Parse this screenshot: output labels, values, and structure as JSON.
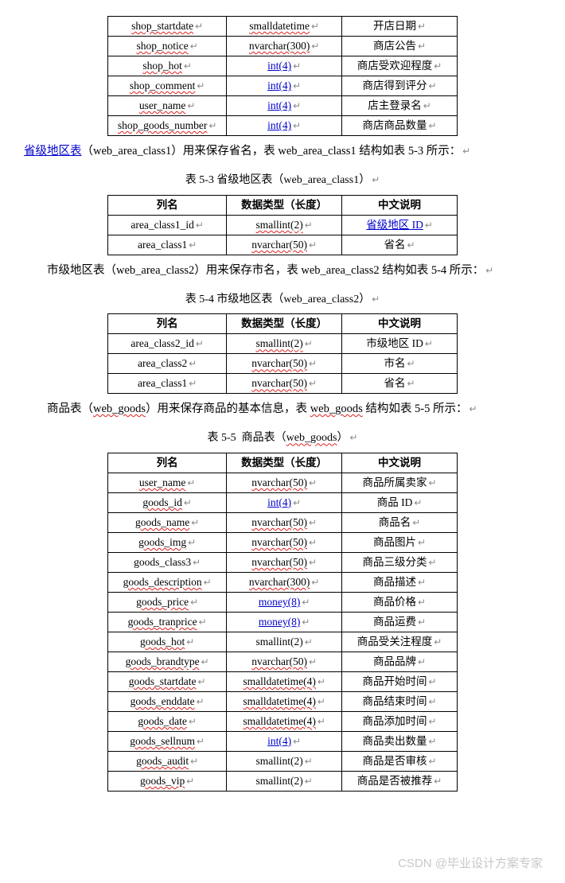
{
  "table1": {
    "rows": [
      {
        "c1": "shop_startdate",
        "c1_err": true,
        "c2": "smalldatetime",
        "c2_err": true,
        "c3": "开店日期"
      },
      {
        "c1": "shop_notice",
        "c1_err": true,
        "c2": "nvarchar(300)",
        "c2_err": true,
        "c3": "商店公告"
      },
      {
        "c1": "shop_hot",
        "c1_err": true,
        "c2": "int(4)",
        "c2_link": true,
        "c3": "商店受欢迎程度"
      },
      {
        "c1": "shop_comment",
        "c1_err": true,
        "c2": "int(4)",
        "c2_link": true,
        "c3": "商店得到评分"
      },
      {
        "c1": "user_name",
        "c1_err": true,
        "c2": "int(4)",
        "c2_link": true,
        "c3": "店主登录名"
      },
      {
        "c1": "shop_goods_number",
        "c1_err": true,
        "c2": "int(4)",
        "c2_link": true,
        "c3": "商店商品数量"
      }
    ]
  },
  "para1_text": "省级地区表（web_area_class1）用来保存省名，表 web_area_class1 结构如表 5-3 所示：",
  "caption53": "表 5-3  省级地区表（web_area_class1）",
  "table53": {
    "header": {
      "c1": "列名",
      "c2": "数据类型（长度）",
      "c3": "中文说明"
    },
    "rows": [
      {
        "c1": "area_class1_id",
        "c2": "smallint(2)",
        "c2_err": true,
        "c3": "省级地区 ID",
        "c3_link": true
      },
      {
        "c1": "area_class1",
        "c2": "nvarchar(50)",
        "c2_err": true,
        "c3": "省名"
      }
    ]
  },
  "para2_text": "市级地区表（web_area_class2）用来保存市名，表 web_area_class2 结构如表 5-4 所示：",
  "caption54": "表 5-4  市级地区表（web_area_class2）",
  "table54": {
    "header": {
      "c1": "列名",
      "c2": "数据类型（长度）",
      "c3": "中文说明"
    },
    "rows": [
      {
        "c1": "area_class2_id",
        "c2": "smallint(2)",
        "c2_err": true,
        "c3": "市级地区 ID"
      },
      {
        "c1": "area_class2",
        "c2": "nvarchar(50)",
        "c2_err": true,
        "c3": "市名"
      },
      {
        "c1": "area_class1",
        "c2": "nvarchar(50)",
        "c2_err": true,
        "c3": "省名"
      }
    ]
  },
  "para3_text": "商品表（web_goods）用来保存商品的基本信息，表 web_goods 结构如表 5-5 所示：",
  "caption55": "表 5-5  商品表（web_goods）",
  "table55": {
    "header": {
      "c1": "列名",
      "c2": "数据类型（长度）",
      "c3": "中文说明"
    },
    "rows": [
      {
        "c1": "user_name",
        "c1_err": true,
        "c2": "nvarchar(50)",
        "c2_err": true,
        "c3": "商品所属卖家"
      },
      {
        "c1": "goods_id",
        "c1_err": true,
        "c2": "int(4)",
        "c2_link": true,
        "c3": "商品 ID"
      },
      {
        "c1": "goods_name",
        "c1_err": true,
        "c2": "nvarchar(50)",
        "c2_err": true,
        "c3": "商品名"
      },
      {
        "c1": "goods_img",
        "c1_err": true,
        "c2": "nvarchar(50)",
        "c2_err": true,
        "c3": "商品图片"
      },
      {
        "c1": "goods_class3",
        "c2": "nvarchar(50)",
        "c2_err": true,
        "c3": "商品三级分类"
      },
      {
        "c1": "goods_description",
        "c1_err": true,
        "c2": "nvarchar(300)",
        "c2_err": true,
        "c3": "商品描述"
      },
      {
        "c1": "goods_price",
        "c1_err": true,
        "c2": "money(8)",
        "c2_link": true,
        "c3": "商品价格"
      },
      {
        "c1": "goods_tranprice",
        "c1_err": true,
        "c2": "money(8)",
        "c2_link": true,
        "c3": "商品运费"
      },
      {
        "c1": "goods_hot",
        "c1_err": true,
        "c2": "smallint(2)",
        "c3": "商品受关注程度"
      },
      {
        "c1": "goods_brandtype",
        "c1_err": true,
        "c2": "nvarchar(50)",
        "c2_err": true,
        "c3": "商品品牌"
      },
      {
        "c1": "goods_startdate",
        "c1_err": true,
        "c2": "smalldatetime(4)",
        "c2_err": true,
        "c3": "商品开始时间"
      },
      {
        "c1": "goods_enddate",
        "c1_err": true,
        "c2": "smalldatetime(4)",
        "c2_err": true,
        "c3": "商品结束时间"
      },
      {
        "c1": "goods_date",
        "c1_err": true,
        "c2": "smalldatetime(4)",
        "c2_err": true,
        "c3": "商品添加时间"
      },
      {
        "c1": "goods_sellnum",
        "c1_err": true,
        "c2": "int(4)",
        "c2_link": true,
        "c3": "商品卖出数量"
      },
      {
        "c1": "goods_audit",
        "c1_err": true,
        "c2": "smallint(2)",
        "c3": "商品是否审核"
      },
      {
        "c1": "goods_vip",
        "c1_err": true,
        "c2": "smallint(2)",
        "c3": "商品是否被推荐"
      }
    ]
  },
  "watermark": "CSDN @毕业设计方案专家"
}
